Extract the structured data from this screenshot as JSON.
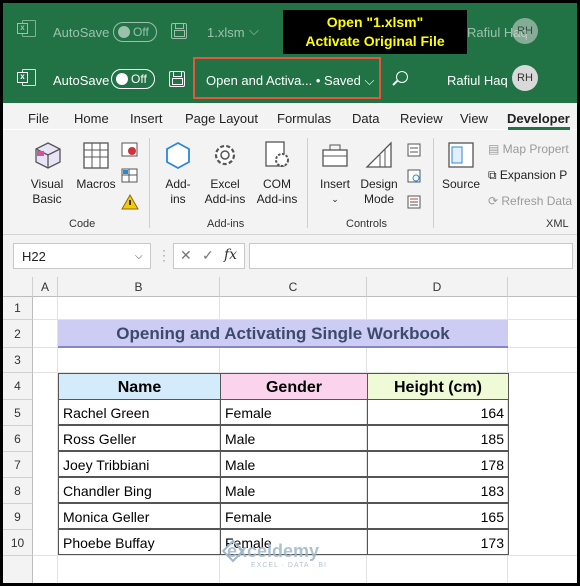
{
  "titlebar_back": {
    "autosave_label": "AutoSave",
    "toggle_state": "Off",
    "filename": "1.xlsm",
    "user_name": "Rafiul Haq",
    "avatar_initials": "RH"
  },
  "callout": {
    "line1": "Open \"1.xlsm\"",
    "line2": "Activate Original File"
  },
  "titlebar_front": {
    "autosave_label": "AutoSave",
    "toggle_state": "Off",
    "document_title": "Open and Activa...",
    "save_status": "Saved",
    "user_name": "Rafiul Haq",
    "avatar_initials": "RH"
  },
  "tabs": [
    "File",
    "Home",
    "Insert",
    "Page Layout",
    "Formulas",
    "Data",
    "Review",
    "View",
    "Developer"
  ],
  "active_tab": "Developer",
  "ribbon": {
    "code_group": {
      "label": "Code",
      "visual_basic": "Visual Basic",
      "macros": "Macros"
    },
    "addins_group": {
      "label": "Add-ins",
      "addins": "Add-ins",
      "excel_addins": "Excel Add-ins",
      "com_addins": "COM Add-ins"
    },
    "controls_group": {
      "label": "Controls",
      "insert": "Insert",
      "design_mode": "Design Mode"
    },
    "xml_group": {
      "label": "XML",
      "source": "Source",
      "map_properties": "Map Propert",
      "expansion_packs": "Expansion P",
      "refresh_data": "Refresh Data"
    }
  },
  "formula_bar": {
    "cell_ref": "H22",
    "formula": ""
  },
  "columns": [
    "A",
    "B",
    "C",
    "D"
  ],
  "rows": [
    "1",
    "2",
    "3",
    "4",
    "5",
    "6",
    "7",
    "8",
    "9",
    "10"
  ],
  "sheet_title": "Opening and Activating Single Workbook",
  "table": {
    "headers": [
      "Name",
      "Gender",
      "Height (cm)"
    ],
    "header_colors": [
      "#d3ebfa",
      "#fbd3ec",
      "#eefbd6"
    ],
    "rows": [
      [
        "Rachel Green",
        "Female",
        "164"
      ],
      [
        "Ross Geller",
        "Male",
        "185"
      ],
      [
        "Joey Tribbiani",
        "Male",
        "178"
      ],
      [
        "Chandler Bing",
        "Male",
        "183"
      ],
      [
        "Monica Geller",
        "Female",
        "165"
      ],
      [
        "Phoebe Buffay",
        "Female",
        "173"
      ]
    ]
  },
  "watermark": {
    "brand": "exceldemy",
    "tagline": "EXCEL · DATA · BI"
  },
  "colors": {
    "excel_green": "#217346",
    "callout_text": "#ffff00",
    "highlight_border": "#e8553f",
    "title_fill": "#ccccf5"
  }
}
